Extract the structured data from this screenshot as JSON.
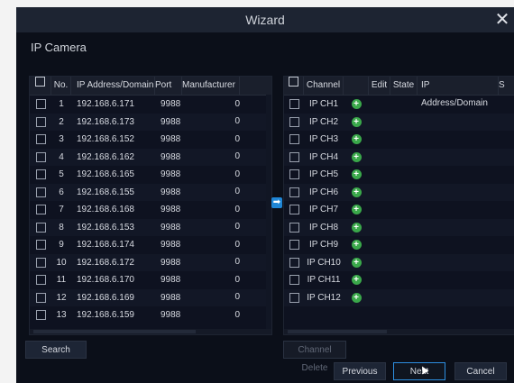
{
  "dialog": {
    "title": "Wizard",
    "close_icon": "close-icon"
  },
  "section": {
    "label": "IP Camera"
  },
  "left_table": {
    "headers": {
      "no": "No.",
      "ip": "IP Address/Domain",
      "port": "Port",
      "manufacturer": "Manufacturer"
    },
    "rows": [
      {
        "no": "1",
        "ip": "192.168.6.171",
        "port": "9988",
        "man": "0"
      },
      {
        "no": "2",
        "ip": "192.168.6.173",
        "port": "9988",
        "man": "0"
      },
      {
        "no": "3",
        "ip": "192.168.6.152",
        "port": "9988",
        "man": "0"
      },
      {
        "no": "4",
        "ip": "192.168.6.162",
        "port": "9988",
        "man": "0"
      },
      {
        "no": "5",
        "ip": "192.168.6.165",
        "port": "9988",
        "man": "0"
      },
      {
        "no": "6",
        "ip": "192.168.6.155",
        "port": "9988",
        "man": "0"
      },
      {
        "no": "7",
        "ip": "192.168.6.168",
        "port": "9988",
        "man": "0"
      },
      {
        "no": "8",
        "ip": "192.168.6.153",
        "port": "9988",
        "man": "0"
      },
      {
        "no": "9",
        "ip": "192.168.6.174",
        "port": "9988",
        "man": "0"
      },
      {
        "no": "10",
        "ip": "192.168.6.172",
        "port": "9988",
        "man": "0"
      },
      {
        "no": "11",
        "ip": "192.168.6.170",
        "port": "9988",
        "man": "0"
      },
      {
        "no": "12",
        "ip": "192.168.6.169",
        "port": "9988",
        "man": "0"
      },
      {
        "no": "13",
        "ip": "192.168.6.159",
        "port": "9988",
        "man": "0"
      }
    ]
  },
  "right_table": {
    "headers": {
      "channel": "Channel",
      "edit": "Edit",
      "state": "State",
      "ip": "IP Address/Domain",
      "s": "S"
    },
    "rows": [
      {
        "channel": "IP CH1"
      },
      {
        "channel": "IP CH2"
      },
      {
        "channel": "IP CH3"
      },
      {
        "channel": "IP CH4"
      },
      {
        "channel": "IP CH5"
      },
      {
        "channel": "IP CH6"
      },
      {
        "channel": "IP CH7"
      },
      {
        "channel": "IP CH8"
      },
      {
        "channel": "IP CH9"
      },
      {
        "channel": "IP CH10"
      },
      {
        "channel": "IP CH11"
      },
      {
        "channel": "IP CH12"
      }
    ]
  },
  "buttons": {
    "search": "Search",
    "channel_delete": "Channel Delete",
    "previous": "Previous",
    "next": "Next",
    "cancel": "Cancel"
  },
  "colors": {
    "accent": "#1f86d6",
    "add": "#3aa84a",
    "background": "#0b0f19"
  }
}
